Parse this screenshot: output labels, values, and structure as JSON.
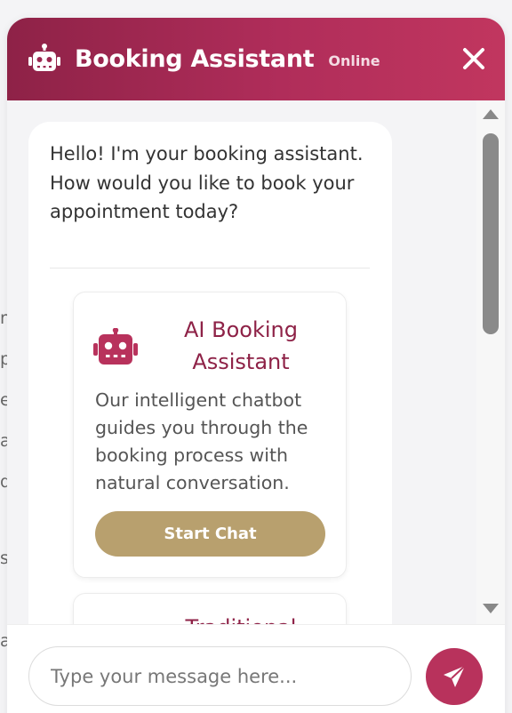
{
  "background_fragments": [
    "n",
    "p",
    "e",
    "a",
    "d.",
    "s",
    "a"
  ],
  "header": {
    "title": "Booking Assistant",
    "status": "Online",
    "bot_icon": "robot-icon",
    "close_icon": "close-icon",
    "gradient_start": "#8e2247",
    "gradient_end": "#c1365f"
  },
  "messages": {
    "greeting": "Hello! I'm your booking assistant. How would you like to book your appointment today?",
    "options": [
      {
        "icon": "robot-icon",
        "title": "AI Booking Assistant",
        "description": "Our intelligent chatbot guides you through the booking process with natural conversation.",
        "button_label": "Start Chat"
      },
      {
        "title": "Traditional"
      }
    ]
  },
  "composer": {
    "placeholder": "Type your message here...",
    "value": "",
    "send_icon": "paper-plane-icon"
  },
  "colors": {
    "accent": "#b8325c",
    "brand_dark": "#8e2247",
    "button_gold": "#b8a06e"
  }
}
